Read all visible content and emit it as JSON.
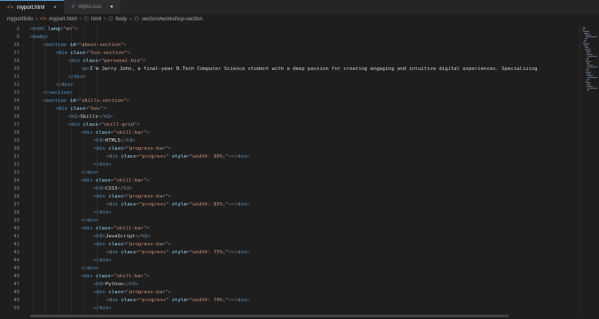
{
  "tabs": [
    {
      "label": "myport.html",
      "icon": "html-file-icon",
      "active": true,
      "close": "×"
    },
    {
      "label": "styles.css",
      "icon": "css-file-icon",
      "active": false,
      "dirty": "●"
    }
  ],
  "breadcrumb": [
    "myportfolio",
    "myport.html",
    "html",
    "body",
    "section#workshop-section"
  ],
  "lines": [
    {
      "n": "2",
      "indent": 0,
      "tokens": [
        [
          "t",
          "<"
        ],
        [
          "g",
          "html"
        ],
        [
          "a",
          " lang"
        ],
        [
          "t",
          "="
        ],
        [
          "s",
          "\"en\""
        ],
        [
          "t",
          ">"
        ]
      ]
    },
    {
      "n": "9",
      "indent": 0,
      "tokens": [
        [
          "t",
          "<"
        ],
        [
          "g",
          "body"
        ],
        [
          "t",
          ">"
        ]
      ]
    },
    {
      "n": "16",
      "indent": 1,
      "tokens": [
        [
          "t",
          "<"
        ],
        [
          "g",
          "section"
        ],
        [
          "a",
          " id"
        ],
        [
          "t",
          "="
        ],
        [
          "s",
          "\"about-section\""
        ],
        [
          "t",
          ">"
        ]
      ]
    },
    {
      "n": "17",
      "indent": 2,
      "tokens": [
        [
          "t",
          "<"
        ],
        [
          "g",
          "div"
        ],
        [
          "a",
          " class"
        ],
        [
          "t",
          "="
        ],
        [
          "s",
          "\"bio-section\""
        ],
        [
          "t",
          ">"
        ]
      ]
    },
    {
      "n": "18",
      "indent": 3,
      "tokens": [
        [
          "t",
          "<"
        ],
        [
          "g",
          "div"
        ],
        [
          "a",
          " class"
        ],
        [
          "t",
          "="
        ],
        [
          "s",
          "\"personal-bio\""
        ],
        [
          "t",
          ">"
        ]
      ]
    },
    {
      "n": "20",
      "indent": 4,
      "tokens": [
        [
          "t",
          "<"
        ],
        [
          "g",
          "p"
        ],
        [
          "t",
          ">"
        ],
        [
          "x",
          "I'm Jerry John, a final-year B.Tech Computer Science student with a deep passion for creating engaging and intuitive digital experiences. Specializing"
        ]
      ]
    },
    {
      "n": "21",
      "indent": 3,
      "tokens": [
        [
          "t",
          "</"
        ],
        [
          "g",
          "div"
        ],
        [
          "t",
          ">"
        ]
      ]
    },
    {
      "n": "22",
      "indent": 2,
      "tokens": [
        [
          "t",
          "</"
        ],
        [
          "g",
          "div"
        ],
        [
          "t",
          ">"
        ]
      ]
    },
    {
      "n": "23",
      "indent": 1,
      "tokens": [
        [
          "t",
          "</"
        ],
        [
          "g",
          "section"
        ],
        [
          "t",
          ">"
        ]
      ]
    },
    {
      "n": "24",
      "indent": 1,
      "tokens": [
        [
          "t",
          "<"
        ],
        [
          "g",
          "section"
        ],
        [
          "a",
          " id"
        ],
        [
          "t",
          "="
        ],
        [
          "s",
          "\"skills-section\""
        ],
        [
          "t",
          ">"
        ]
      ]
    },
    {
      "n": "25",
      "indent": 2,
      "tokens": [
        [
          "t",
          "<"
        ],
        [
          "g",
          "div"
        ],
        [
          "a",
          " class"
        ],
        [
          "t",
          "="
        ],
        [
          "s",
          "\"box\""
        ],
        [
          "t",
          ">"
        ]
      ]
    },
    {
      "n": "26",
      "indent": 3,
      "tokens": [
        [
          "t",
          "<"
        ],
        [
          "g",
          "h2"
        ],
        [
          "t",
          ">"
        ],
        [
          "x",
          "Skills"
        ],
        [
          "t",
          "</"
        ],
        [
          "g",
          "h2"
        ],
        [
          "t",
          ">"
        ]
      ]
    },
    {
      "n": "27",
      "indent": 3,
      "tokens": [
        [
          "t",
          "<"
        ],
        [
          "g",
          "div"
        ],
        [
          "a",
          " class"
        ],
        [
          "t",
          "="
        ],
        [
          "s",
          "\"skill-grid\""
        ],
        [
          "t",
          ">"
        ]
      ]
    },
    {
      "n": "28",
      "indent": 4,
      "tokens": [
        [
          "t",
          "<"
        ],
        [
          "g",
          "div"
        ],
        [
          "a",
          " class"
        ],
        [
          "t",
          "="
        ],
        [
          "s",
          "\"skill-bar\""
        ],
        [
          "t",
          ">"
        ]
      ]
    },
    {
      "n": "29",
      "indent": 5,
      "tokens": [
        [
          "t",
          "<"
        ],
        [
          "g",
          "h3"
        ],
        [
          "t",
          ">"
        ],
        [
          "x",
          "HTML5"
        ],
        [
          "t",
          "</"
        ],
        [
          "g",
          "h3"
        ],
        [
          "t",
          ">"
        ]
      ]
    },
    {
      "n": "30",
      "indent": 5,
      "tokens": [
        [
          "t",
          "<"
        ],
        [
          "g",
          "div"
        ],
        [
          "a",
          " class"
        ],
        [
          "t",
          "="
        ],
        [
          "s",
          "\"progress-bar\""
        ],
        [
          "t",
          ">"
        ]
      ]
    },
    {
      "n": "31",
      "indent": 6,
      "tokens": [
        [
          "t",
          "<"
        ],
        [
          "g",
          "div"
        ],
        [
          "a",
          " class"
        ],
        [
          "t",
          "="
        ],
        [
          "s",
          "\"progress\""
        ],
        [
          "a",
          " style"
        ],
        [
          "t",
          "="
        ],
        [
          "s",
          "\"width: 90%;\""
        ],
        [
          "t",
          "></"
        ],
        [
          "g",
          "div"
        ],
        [
          "t",
          ">"
        ]
      ]
    },
    {
      "n": "32",
      "indent": 5,
      "tokens": [
        [
          "t",
          "</"
        ],
        [
          "g",
          "div"
        ],
        [
          "t",
          ">"
        ]
      ]
    },
    {
      "n": "33",
      "indent": 4,
      "tokens": [
        [
          "t",
          "</"
        ],
        [
          "g",
          "div"
        ],
        [
          "t",
          ">"
        ]
      ]
    },
    {
      "n": "34",
      "indent": 4,
      "tokens": [
        [
          "t",
          "<"
        ],
        [
          "g",
          "div"
        ],
        [
          "a",
          " class"
        ],
        [
          "t",
          "="
        ],
        [
          "s",
          "\"skill-bar\""
        ],
        [
          "t",
          ">"
        ]
      ]
    },
    {
      "n": "35",
      "indent": 5,
      "tokens": [
        [
          "t",
          "<"
        ],
        [
          "g",
          "h3"
        ],
        [
          "t",
          ">"
        ],
        [
          "x",
          "CSS3"
        ],
        [
          "t",
          "</"
        ],
        [
          "g",
          "h3"
        ],
        [
          "t",
          ">"
        ]
      ]
    },
    {
      "n": "36",
      "indent": 5,
      "tokens": [
        [
          "t",
          "<"
        ],
        [
          "g",
          "div"
        ],
        [
          "a",
          " class"
        ],
        [
          "t",
          "="
        ],
        [
          "s",
          "\"progress-bar\""
        ],
        [
          "t",
          ">"
        ]
      ]
    },
    {
      "n": "37",
      "indent": 6,
      "tokens": [
        [
          "t",
          "<"
        ],
        [
          "g",
          "div"
        ],
        [
          "a",
          " class"
        ],
        [
          "t",
          "="
        ],
        [
          "s",
          "\"progress\""
        ],
        [
          "a",
          " style"
        ],
        [
          "t",
          "="
        ],
        [
          "s",
          "\"width: 85%;\""
        ],
        [
          "t",
          "></"
        ],
        [
          "g",
          "div"
        ],
        [
          "t",
          ">"
        ]
      ]
    },
    {
      "n": "38",
      "indent": 5,
      "tokens": [
        [
          "t",
          "</"
        ],
        [
          "g",
          "div"
        ],
        [
          "t",
          ">"
        ]
      ]
    },
    {
      "n": "39",
      "indent": 4,
      "tokens": [
        [
          "t",
          "</"
        ],
        [
          "g",
          "div"
        ],
        [
          "t",
          ">"
        ]
      ]
    },
    {
      "n": "40",
      "indent": 4,
      "tokens": [
        [
          "t",
          "<"
        ],
        [
          "g",
          "div"
        ],
        [
          "a",
          " class"
        ],
        [
          "t",
          "="
        ],
        [
          "s",
          "\"skill-bar\""
        ],
        [
          "t",
          ">"
        ]
      ]
    },
    {
      "n": "41",
      "indent": 5,
      "tokens": [
        [
          "t",
          "<"
        ],
        [
          "g",
          "h3"
        ],
        [
          "t",
          ">"
        ],
        [
          "x",
          "JavaScript"
        ],
        [
          "t",
          "</"
        ],
        [
          "g",
          "h3"
        ],
        [
          "t",
          ">"
        ]
      ]
    },
    {
      "n": "42",
      "indent": 5,
      "tokens": [
        [
          "t",
          "<"
        ],
        [
          "g",
          "div"
        ],
        [
          "a",
          " class"
        ],
        [
          "t",
          "="
        ],
        [
          "s",
          "\"progress-bar\""
        ],
        [
          "t",
          ">"
        ]
      ]
    },
    {
      "n": "43",
      "indent": 6,
      "tokens": [
        [
          "t",
          "<"
        ],
        [
          "g",
          "div"
        ],
        [
          "a",
          " class"
        ],
        [
          "t",
          "="
        ],
        [
          "s",
          "\"progress\""
        ],
        [
          "a",
          " style"
        ],
        [
          "t",
          "="
        ],
        [
          "s",
          "\"width: 75%;\""
        ],
        [
          "t",
          "></"
        ],
        [
          "g",
          "div"
        ],
        [
          "t",
          ">"
        ]
      ]
    },
    {
      "n": "44",
      "indent": 5,
      "tokens": [
        [
          "t",
          "</"
        ],
        [
          "g",
          "div"
        ],
        [
          "t",
          ">"
        ]
      ]
    },
    {
      "n": "45",
      "indent": 4,
      "tokens": [
        [
          "t",
          "</"
        ],
        [
          "g",
          "div"
        ],
        [
          "t",
          ">"
        ]
      ]
    },
    {
      "n": "46",
      "indent": 4,
      "tokens": [
        [
          "t",
          "<"
        ],
        [
          "g",
          "div"
        ],
        [
          "a",
          " class"
        ],
        [
          "t",
          "="
        ],
        [
          "s",
          "\"skill-bar\""
        ],
        [
          "t",
          ">"
        ]
      ]
    },
    {
      "n": "47",
      "indent": 5,
      "tokens": [
        [
          "t",
          "<"
        ],
        [
          "g",
          "h3"
        ],
        [
          "t",
          ">"
        ],
        [
          "x",
          "Python"
        ],
        [
          "t",
          "</"
        ],
        [
          "g",
          "h3"
        ],
        [
          "t",
          ">"
        ]
      ]
    },
    {
      "n": "48",
      "indent": 5,
      "tokens": [
        [
          "t",
          "<"
        ],
        [
          "g",
          "div"
        ],
        [
          "a",
          " class"
        ],
        [
          "t",
          "="
        ],
        [
          "s",
          "\"progress-bar\""
        ],
        [
          "t",
          ">"
        ]
      ]
    },
    {
      "n": "49",
      "indent": 6,
      "tokens": [
        [
          "t",
          "<"
        ],
        [
          "g",
          "div"
        ],
        [
          "a",
          " class"
        ],
        [
          "t",
          "="
        ],
        [
          "s",
          "\"progress\""
        ],
        [
          "a",
          " style"
        ],
        [
          "t",
          "="
        ],
        [
          "s",
          "\"width: 70%;\""
        ],
        [
          "t",
          "></"
        ],
        [
          "g",
          "div"
        ],
        [
          "t",
          ">"
        ]
      ]
    },
    {
      "n": "50",
      "indent": 5,
      "tokens": [
        [
          "t",
          "</"
        ],
        [
          "g",
          "div"
        ],
        [
          "t",
          ">"
        ]
      ]
    }
  ],
  "colors": {
    "tag": "#569cd6",
    "attr": "#9cdcfe",
    "string": "#ce9178",
    "text": "#d4d4d4",
    "punct": "#808080",
    "background": "#1e1e1e"
  }
}
